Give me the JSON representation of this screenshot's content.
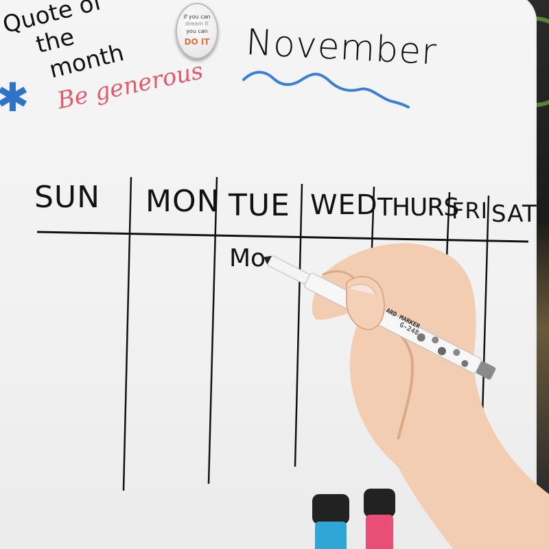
{
  "board": {
    "quote_lines": [
      "Quote of",
      "the",
      "month"
    ],
    "quote_text": "Be generous",
    "month": "November",
    "days": [
      "SUN",
      "MON",
      "TUE",
      "WED",
      "THURS",
      "FRI",
      "SAT"
    ],
    "entry": "Mo"
  },
  "magnet": {
    "line1": "if you can",
    "line2": "dream it",
    "line3": "you can",
    "line4": "DO IT"
  },
  "marker": {
    "label": "ARD MARKER",
    "code": "G-248"
  },
  "colors": {
    "board": "#f3f3f3",
    "ink": "#111111",
    "quote_ink": "#e35a6a",
    "underline": "#3b7fd4",
    "eraser_blue": "#2fa6d6",
    "eraser_pink": "#e94f76"
  }
}
